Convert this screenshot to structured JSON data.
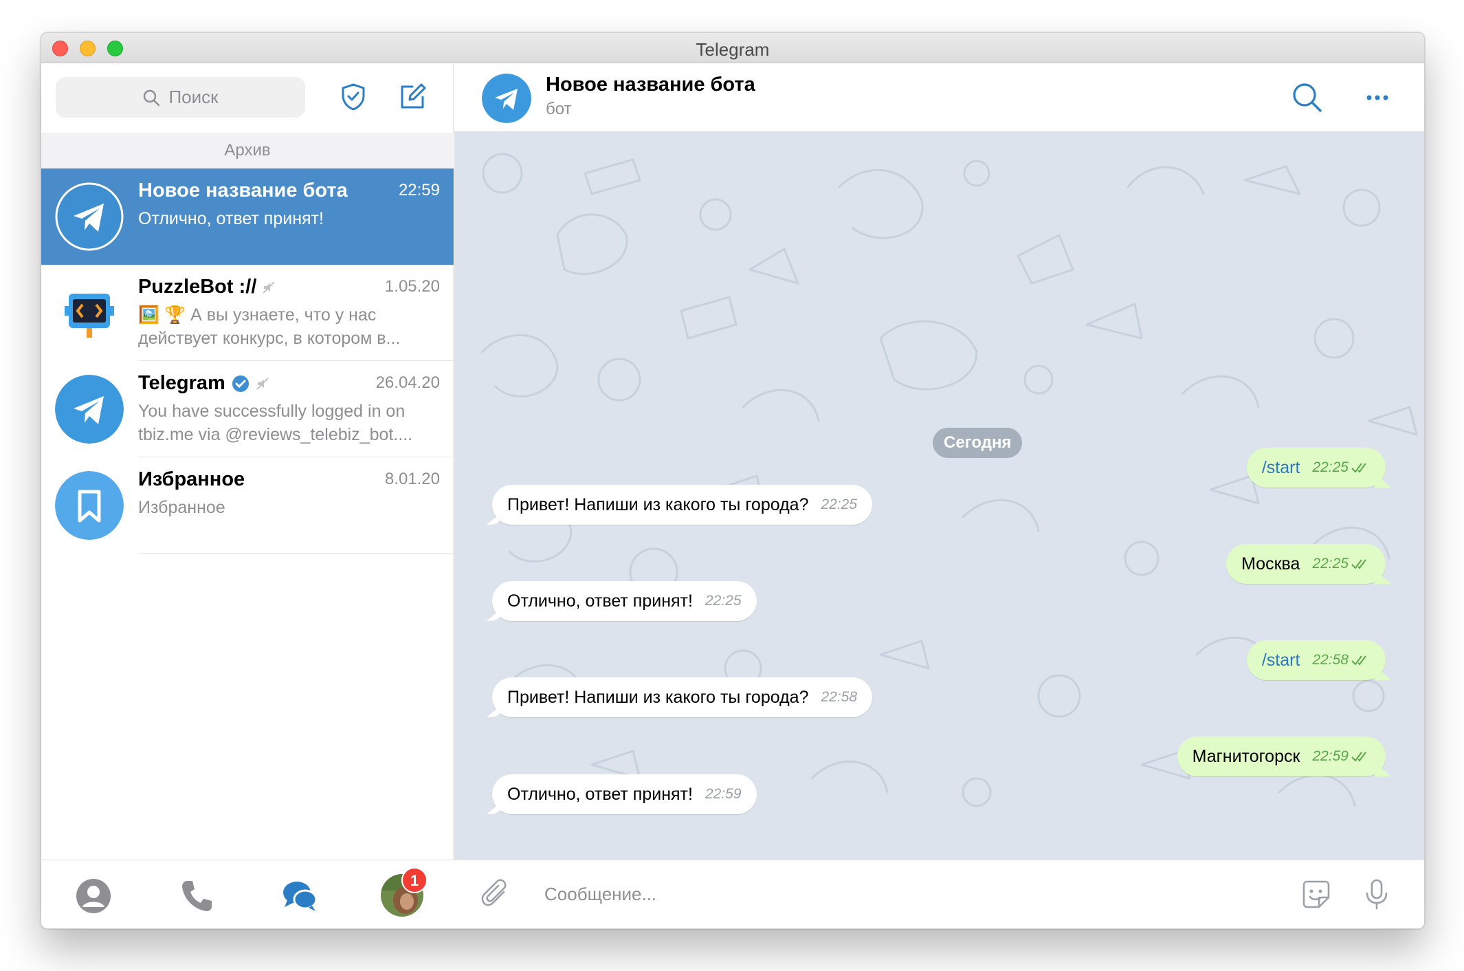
{
  "window": {
    "title": "Telegram"
  },
  "sidebar": {
    "search_placeholder": "Поиск",
    "archive_label": "Архив",
    "chats": [
      {
        "name": "Новое название бота",
        "time": "22:59",
        "preview": "Отлично, ответ принят!",
        "active": true
      },
      {
        "name": "PuzzleBot ://",
        "time": "1.05.20",
        "preview": "🖼️ 🏆 А вы узнаете, что у нас действует конкурс, в котором в...",
        "muted": true
      },
      {
        "name": "Telegram",
        "time": "26.04.20",
        "preview": "You have successfully logged in on tbiz.me via @reviews_telebiz_bot....",
        "verified": true,
        "muted": true
      },
      {
        "name": "Избранное",
        "time": "8.01.20",
        "preview": "Избранное"
      }
    ],
    "nav": {
      "badge_count": "1"
    }
  },
  "chat": {
    "title": "Новое название бота",
    "subtitle": "бот",
    "date_label": "Сегодня",
    "messages": [
      {
        "dir": "out",
        "text": "/start",
        "time": "22:25"
      },
      {
        "dir": "in",
        "text": "Привет! Напиши из какого ты города?",
        "time": "22:25"
      },
      {
        "dir": "out",
        "text": "Москва",
        "time": "22:25"
      },
      {
        "dir": "in",
        "text": "Отлично, ответ принят!",
        "time": "22:25"
      },
      {
        "dir": "out",
        "text": "/start",
        "time": "22:58"
      },
      {
        "dir": "in",
        "text": "Привет! Напиши из какого ты города?",
        "time": "22:58"
      },
      {
        "dir": "out",
        "text": "Магнитогорск",
        "time": "22:59"
      },
      {
        "dir": "in",
        "text": "Отлично, ответ принят!",
        "time": "22:59"
      }
    ],
    "composer_placeholder": "Сообщение..."
  },
  "colors": {
    "accent": "#2b7ec6",
    "active_chat": "#4a8cc9",
    "outgoing_bubble": "#e1fbc7",
    "chat_background": "#dce3ec"
  }
}
